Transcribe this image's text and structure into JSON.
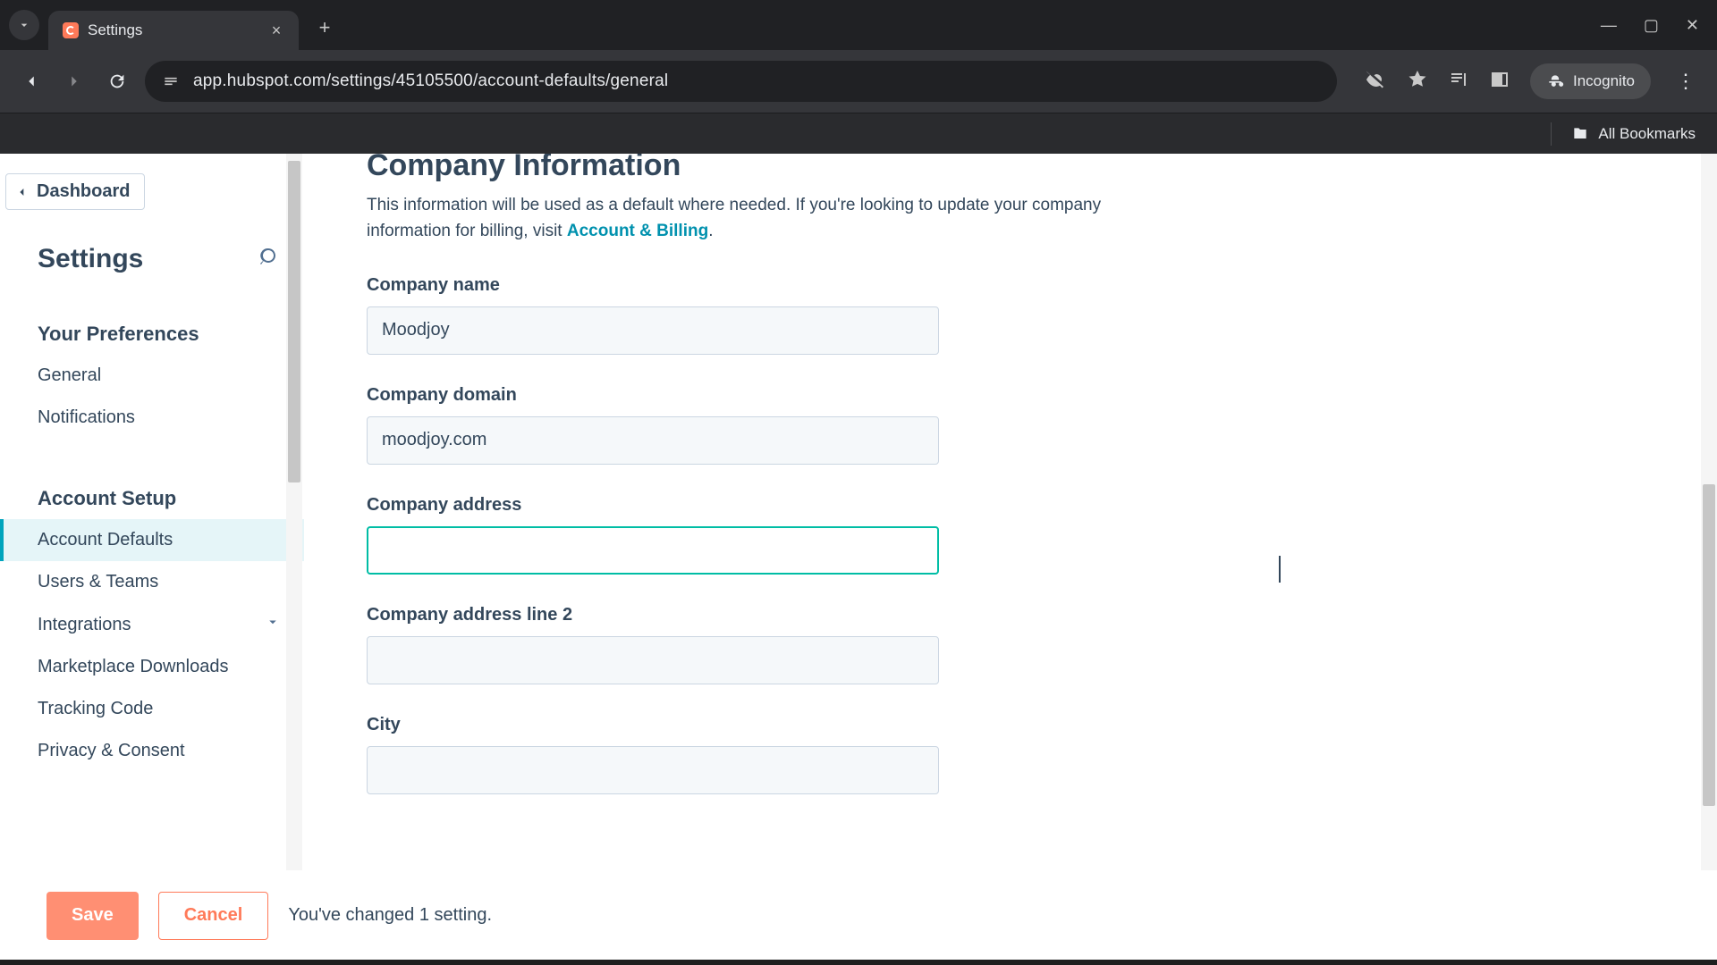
{
  "browser": {
    "tab_title": "Settings",
    "url": "app.hubspot.com/settings/45105500/account-defaults/general",
    "incognito_label": "Incognito",
    "all_bookmarks": "All Bookmarks"
  },
  "sidebar": {
    "back_label": "Dashboard",
    "title": "Settings",
    "section_prefs": "Your Preferences",
    "items_prefs": [
      "General",
      "Notifications"
    ],
    "section_setup": "Account Setup",
    "items_setup": [
      "Account Defaults",
      "Users & Teams",
      "Integrations",
      "Marketplace Downloads",
      "Tracking Code",
      "Privacy & Consent"
    ],
    "active_index_setup": 0,
    "expandable": {
      "Integrations": true
    }
  },
  "page": {
    "heading": "Company Information",
    "lead_pre": "This information will be used as a default where needed. If you're looking to update your company information for billing, visit ",
    "lead_link": "Account & Billing",
    "lead_post": ".",
    "fields": {
      "company_name": {
        "label": "Company name",
        "value": "Moodjoy"
      },
      "company_domain": {
        "label": "Company domain",
        "value": "moodjoy.com"
      },
      "company_address": {
        "label": "Company address",
        "value": ""
      },
      "company_address2": {
        "label": "Company address line 2",
        "value": ""
      },
      "city": {
        "label": "City",
        "value": ""
      }
    }
  },
  "savebar": {
    "save": "Save",
    "cancel": "Cancel",
    "status": "You've changed 1 setting."
  }
}
